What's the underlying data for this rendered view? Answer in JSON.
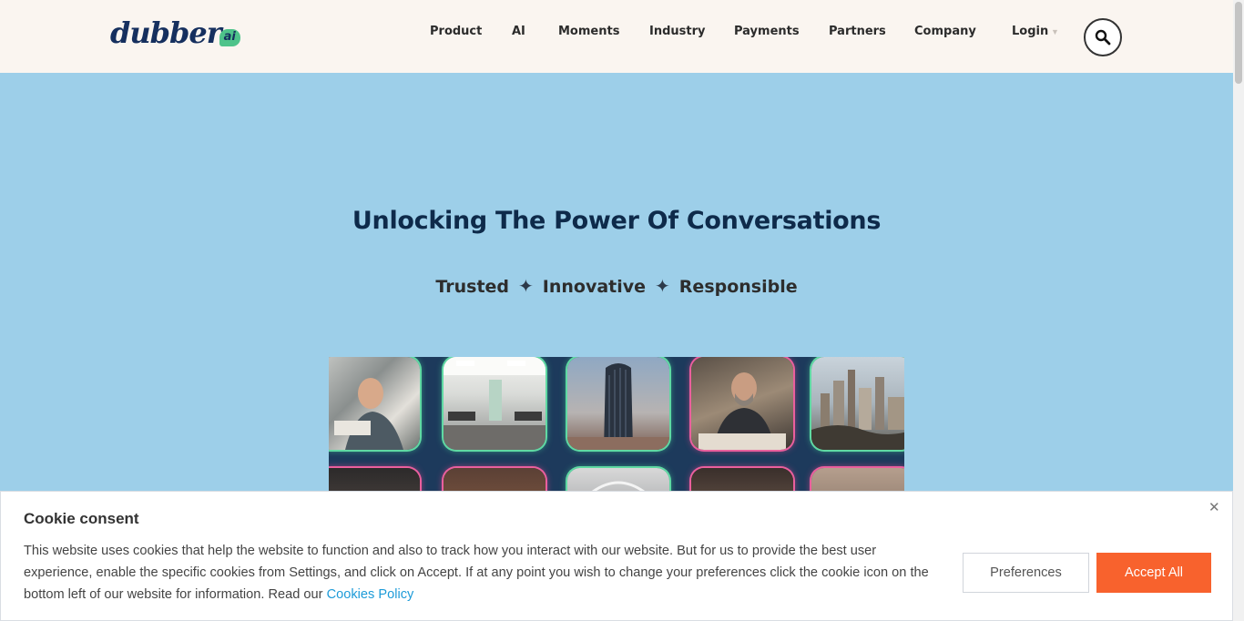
{
  "header": {
    "logo_text": "dubber",
    "logo_badge": "ai",
    "nav": [
      "Product",
      "AI",
      "Moments",
      "Industry",
      "Payments",
      "Partners",
      "Company"
    ],
    "login_label": "Login",
    "search_icon": "search-icon"
  },
  "hero": {
    "title": "Unlocking The Power Of Conversations",
    "tags": [
      "Trusted",
      "Innovative",
      "Responsible"
    ],
    "separator": "✦"
  },
  "cookie": {
    "title": "Cookie consent",
    "body": "This website uses cookies that help the website to function and also to track how you interact with our website. But for us to provide the best user experience, enable the specific cookies from Settings, and click on Accept. If at any point you wish to change your preferences click the cookie icon on the bottom left of our website for information. Read our ",
    "link_text": "Cookies Policy",
    "preferences_label": "Preferences",
    "accept_label": "Accept All",
    "close_icon": "close-icon"
  },
  "colors": {
    "hero_background": "#9dcfe9",
    "header_background": "#faf5f0",
    "accent_orange": "#f8622d",
    "link_blue": "#1d9bd8",
    "tile_glow_green": "#5fd9a3",
    "tile_glow_pink": "#ea5f9d"
  }
}
